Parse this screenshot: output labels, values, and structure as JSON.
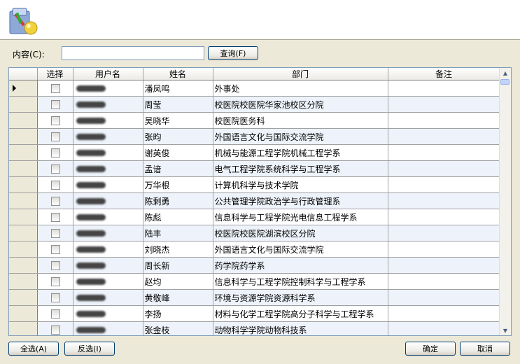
{
  "search": {
    "label": "内容(C):",
    "value": "",
    "placeholder": "",
    "button": "查询(F)"
  },
  "grid": {
    "columns": [
      "选择",
      "用户名",
      "姓名",
      "部门",
      "备注"
    ],
    "rows": [
      {
        "name": "潘凤鸣",
        "dept": "外事处",
        "note": ""
      },
      {
        "name": "周莹",
        "dept": "校医院校医院华家池校区分院",
        "note": ""
      },
      {
        "name": "吴晓华",
        "dept": "校医院医务科",
        "note": ""
      },
      {
        "name": "张昀",
        "dept": "外国语言文化与国际交流学院",
        "note": ""
      },
      {
        "name": "谢英俊",
        "dept": "机械与能源工程学院机械工程学系",
        "note": ""
      },
      {
        "name": "孟谙",
        "dept": "电气工程学院系统科学与工程学系",
        "note": ""
      },
      {
        "name": "万华根",
        "dept": "计算机科学与技术学院",
        "note": ""
      },
      {
        "name": "陈剩勇",
        "dept": "公共管理学院政治学与行政管理系",
        "note": ""
      },
      {
        "name": "陈彪",
        "dept": "信息科学与工程学院光电信息工程学系",
        "note": ""
      },
      {
        "name": "陆丰",
        "dept": "校医院校医院湖滨校区分院",
        "note": ""
      },
      {
        "name": "刘晓杰",
        "dept": "外国语言文化与国际交流学院",
        "note": ""
      },
      {
        "name": "周长新",
        "dept": "药学院药学系",
        "note": ""
      },
      {
        "name": "赵均",
        "dept": "信息科学与工程学院控制科学与工程学系",
        "note": ""
      },
      {
        "name": "黄敬峰",
        "dept": "环境与资源学院资源科学系",
        "note": ""
      },
      {
        "name": "李扬",
        "dept": "材料与化学工程学院高分子科学与工程学系",
        "note": ""
      },
      {
        "name": "张金枝",
        "dept": "动物科学学院动物科技系",
        "note": ""
      }
    ]
  },
  "footer": {
    "select_all": "全选(A)",
    "invert": "反选(I)",
    "ok": "确定",
    "cancel": "取消"
  }
}
